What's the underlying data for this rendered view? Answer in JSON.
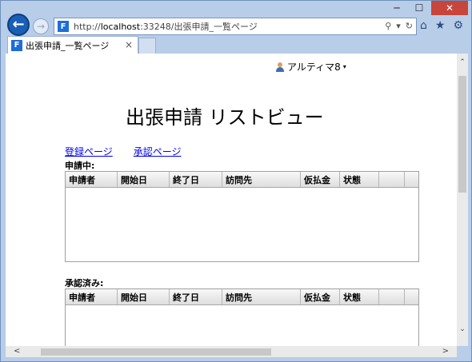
{
  "window": {
    "minimize_glyph": "─",
    "maximize_glyph": "☐",
    "close_glyph": "✕"
  },
  "nav": {
    "back_glyph": "←",
    "forward_glyph": "→",
    "url_scheme": "http://",
    "url_host": "localhost",
    "url_rest": ":33248/出張申請_一覧ページ",
    "address_tools": [
      "search-icon",
      "dropdown-icon",
      "refresh-icon"
    ],
    "search_glyph": "⚲",
    "dropdown_glyph": "▾",
    "refresh_glyph": "↻",
    "toolbar_icons": [
      "home-icon",
      "favorites-icon",
      "settings-icon"
    ],
    "home_glyph": "⌂",
    "favorites_glyph": "★",
    "settings_glyph": "⚙"
  },
  "tab": {
    "title": "出張申請_一覧ページ",
    "close_glyph": "×",
    "site_icon_letter": "F"
  },
  "page": {
    "user_name": "アルティマ8",
    "user_caret": "▾",
    "title": "出張申請 リストビュー",
    "links": {
      "register": "登録ページ",
      "approve": "承認ページ"
    },
    "pending_label": "申請中:",
    "approved_label": "承認済み:",
    "columns": [
      "申請者",
      "開始日",
      "終了日",
      "訪問先",
      "仮払金",
      "状態"
    ]
  },
  "scrollbars": {
    "up_glyph": "⌃",
    "down_glyph": "⌄",
    "left_glyph": "<",
    "right_glyph": ">"
  },
  "colors": {
    "accent": "#1a5eb5",
    "close_button": "#c7453b",
    "link": "#0000ee"
  }
}
